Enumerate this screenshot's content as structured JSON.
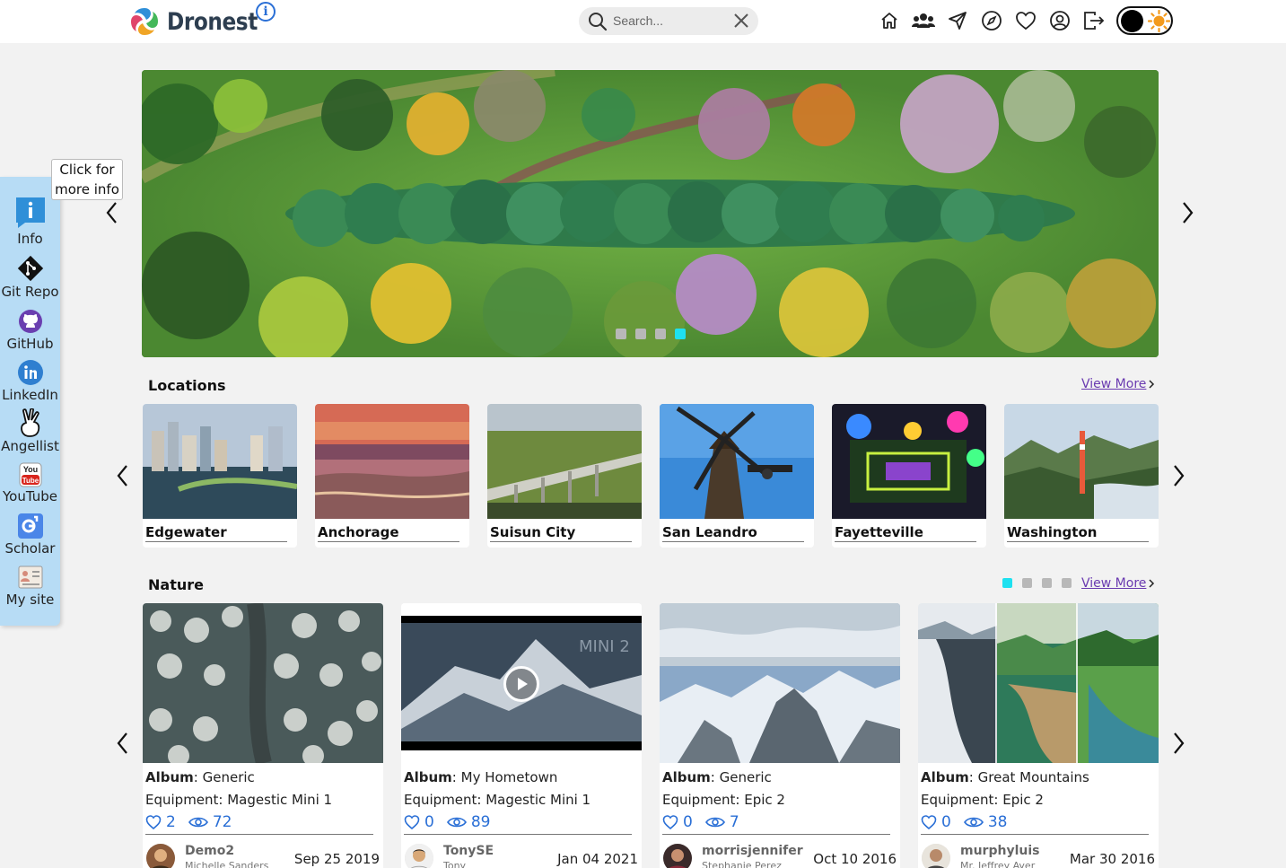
{
  "app": {
    "name": "Dronest"
  },
  "header": {
    "search": {
      "placeholder": "Search..."
    },
    "nav": [
      "home-icon",
      "users-icon",
      "send-icon",
      "compass-icon",
      "heart-icon",
      "profile-icon",
      "logout-icon"
    ],
    "theme": [
      "dark",
      "light"
    ]
  },
  "sidebar": {
    "tooltip": "Click for more info",
    "items": [
      {
        "label": "Info",
        "icon": "info-icon"
      },
      {
        "label": "Git Repo",
        "icon": "git-icon"
      },
      {
        "label": "GitHub",
        "icon": "github-icon"
      },
      {
        "label": "LinkedIn",
        "icon": "linkedin-icon"
      },
      {
        "label": "Angellist",
        "icon": "angellist-icon"
      },
      {
        "label": "YouTube",
        "icon": "youtube-icon"
      },
      {
        "label": "Scholar",
        "icon": "scholar-icon"
      },
      {
        "label": "My site",
        "icon": "site-icon"
      }
    ]
  },
  "hero": {
    "slide_count": 4,
    "active_slide": 4
  },
  "locations": {
    "title": "Locations",
    "view_more": "View More",
    "items": [
      "Edgewater",
      "Anchorage",
      "Suisun City",
      "San Leandro",
      "Fayetteville",
      "Washington"
    ]
  },
  "nature": {
    "title": "Nature",
    "view_more": "View More",
    "page_count": 4,
    "active_page": 1,
    "album_label": "Album",
    "cards": [
      {
        "album": "Generic",
        "equipment": "Equipment: Magestic Mini 1",
        "likes": "2",
        "views": "72",
        "user": "Demo2",
        "name": "Michelle Sanders",
        "date": "Sep 25 2019"
      },
      {
        "album": "My Hometown",
        "equipment": "Equipment: Magestic Mini 1",
        "likes": "0",
        "views": "89",
        "user": "TonySE",
        "name": "Tony",
        "date": "Jan 04 2021",
        "video_text": "MINI 2"
      },
      {
        "album": "Generic",
        "equipment": "Equipment: Epic 2",
        "likes": "0",
        "views": "7",
        "user": "morrisjennifer",
        "name": "Stephanie Perez",
        "date": "Oct 10 2016"
      },
      {
        "album": "Great Mountains",
        "equipment": "Equipment: Epic 2",
        "likes": "0",
        "views": "38",
        "user": "murphyluis",
        "name": "Mr. Jeffrey Ayer",
        "date": "Mar 30 2016"
      }
    ]
  }
}
